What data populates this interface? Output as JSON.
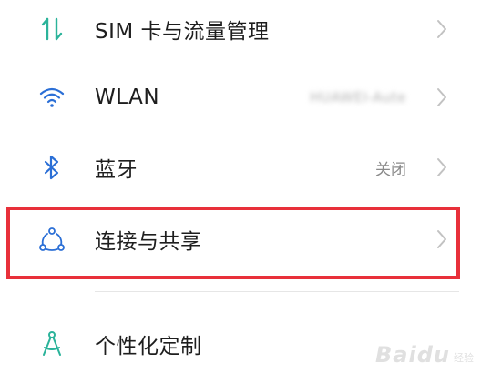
{
  "settings": {
    "items": [
      {
        "label": "SIM 卡与流量管理",
        "value": "",
        "icon": "sim-data-arrows-icon"
      },
      {
        "label": "WLAN",
        "value": "HUAWEI-Aute",
        "icon": "wifi-icon"
      },
      {
        "label": "蓝牙",
        "value": "关闭",
        "icon": "bluetooth-icon"
      },
      {
        "label": "连接与共享",
        "value": "",
        "icon": "connection-share-icon"
      },
      {
        "label": "个性化定制",
        "value": "",
        "icon": "compass-icon"
      }
    ]
  },
  "watermark": {
    "text": "Baidu",
    "sub": "经验"
  },
  "colors": {
    "accent_icon": "#2bb39a",
    "blue_icon": "#2b6fd6",
    "highlight_border": "#e8303a",
    "text": "#1e1e1e",
    "secondary_text": "#8a8a8a",
    "chevron": "#c2c2c2"
  }
}
